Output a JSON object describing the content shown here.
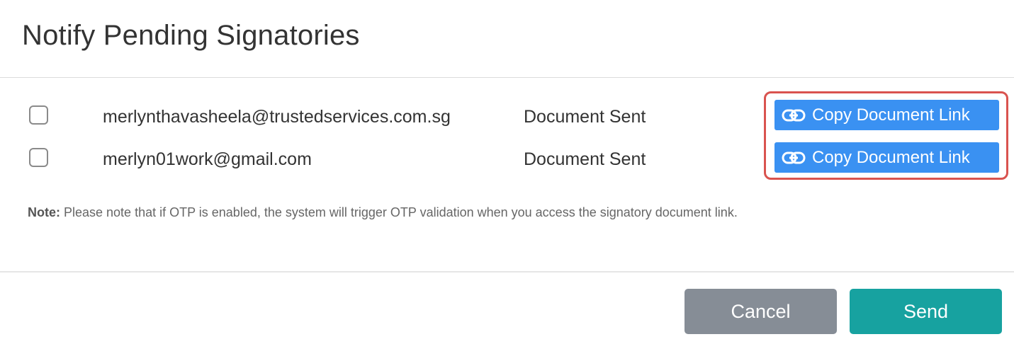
{
  "dialog": {
    "title": "Notify Pending Signatories"
  },
  "signatories": [
    {
      "email": "merlynthavasheela@trustedservices.com.sg",
      "status": "Document Sent",
      "checked": false,
      "copy_link_label": "Copy Document Link"
    },
    {
      "email": "merlyn01work@gmail.com",
      "status": "Document Sent",
      "checked": false,
      "copy_link_label": "Copy Document Link"
    }
  ],
  "note": {
    "label": "Note:",
    "text": " Please note that if OTP is enabled, the system will trigger OTP validation when you access the signatory document link."
  },
  "footer": {
    "cancel_label": "Cancel",
    "send_label": "Send"
  },
  "colors": {
    "copy_button": "#3a91f2",
    "cancel_button": "#868d96",
    "send_button": "#17a2a0",
    "highlight": "#d9534f"
  },
  "icons": {
    "copy_link": "link-icon"
  }
}
